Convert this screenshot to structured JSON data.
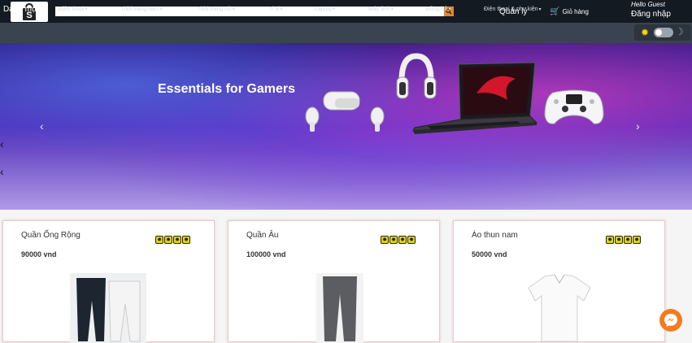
{
  "header": {
    "logo_icon": "shopping-bag-icon",
    "search": {
      "value": "",
      "placeholder": ""
    },
    "manage_label": "Quản lý",
    "cart_label": "Giỏ hàng",
    "greeting": "Hello Guest",
    "login_label": "Đăng nhập"
  },
  "nav": {
    "all_label": "Danh mục",
    "items": [
      {
        "label": "Điện thoại"
      },
      {
        "label": "Thời trang nam"
      },
      {
        "label": "Thời trang nữ"
      },
      {
        "label": "Ti vi"
      },
      {
        "label": "Laptop"
      },
      {
        "label": "Máy ảnh"
      },
      {
        "label": "Đồng hồ"
      },
      {
        "label": "Điện thoại & phụ kiện"
      }
    ],
    "theme_toggle": {
      "light_icon": "sun-icon",
      "dark_icon": "moon-icon",
      "dark_mode": false
    }
  },
  "banner": {
    "title": "Essentials for Gamers",
    "prev_icon": "chevron-left-icon",
    "next_icon": "chevron-right-icon"
  },
  "products": [
    {
      "name": "Quần Ống Rộng",
      "price": "90000 vnd",
      "rating": 4,
      "image": "sweatpants-image"
    },
    {
      "name": "Quần Âu",
      "price": "100000 vnd",
      "rating": 4,
      "image": "trousers-image"
    },
    {
      "name": "Áo thun nam",
      "price": "50000 vnd",
      "rating": 4,
      "image": "polo-shirt-image"
    }
  ],
  "colors": {
    "topbar": "#131a22",
    "navbar": "#3a4450",
    "search_button": "#e08a2c",
    "star": "#e8d800",
    "messenger": "#f47b1e"
  },
  "widgets": {
    "chat_icon": "messenger-icon"
  }
}
